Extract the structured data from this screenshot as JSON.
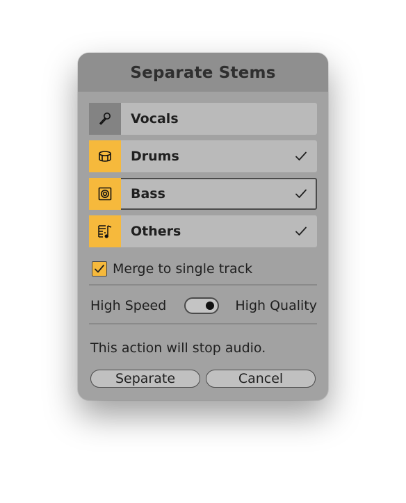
{
  "dialog": {
    "title": "Separate Stems",
    "stems": [
      {
        "label": "Vocals",
        "icon": "microphone-icon",
        "checked": false
      },
      {
        "label": "Drums",
        "icon": "drum-icon",
        "checked": true
      },
      {
        "label": "Bass",
        "icon": "speaker-icon",
        "checked": true
      },
      {
        "label": "Others",
        "icon": "sheet-music-icon",
        "checked": true
      }
    ],
    "check_glyph": "✓",
    "merge": {
      "label": "Merge to single track",
      "checked": true
    },
    "mode": {
      "left_label": "High Speed",
      "right_label": "High Quality",
      "value": "High Quality"
    },
    "message": "This action will stop audio.",
    "buttons": {
      "separate": "Separate",
      "cancel": "Cancel"
    }
  },
  "colors": {
    "accent": "#f6b93c",
    "panel": "#a2a2a2",
    "titlebar": "#8f8f8f",
    "row": "#bababa"
  }
}
